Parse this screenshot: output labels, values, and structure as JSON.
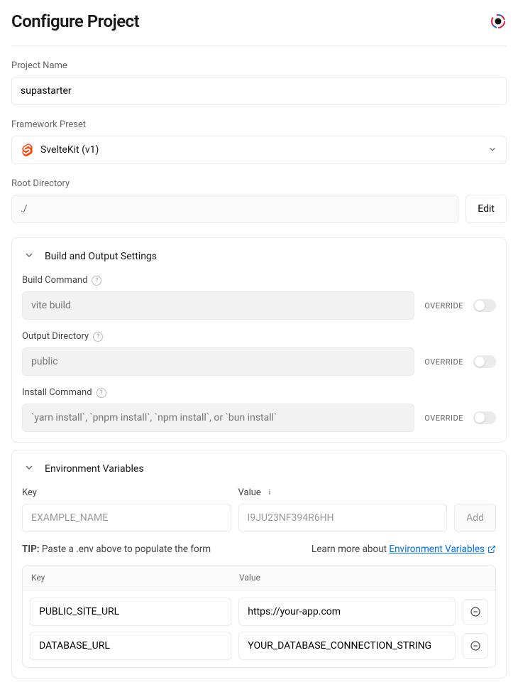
{
  "header": {
    "title": "Configure Project"
  },
  "projectName": {
    "label": "Project Name",
    "value": "supastarter"
  },
  "frameworkPreset": {
    "label": "Framework Preset",
    "value": "SvelteKit (v1)"
  },
  "rootDirectory": {
    "label": "Root Directory",
    "value": "./",
    "editLabel": "Edit"
  },
  "buildPanel": {
    "title": "Build and Output Settings",
    "overrideLabel": "OVERRIDE",
    "buildCommand": {
      "label": "Build Command",
      "placeholder": "vite build"
    },
    "outputDirectory": {
      "label": "Output Directory",
      "placeholder": "public"
    },
    "installCommand": {
      "label": "Install Command",
      "placeholder": "`yarn install`, `pnpm install`, `npm install`, or `bun install`"
    }
  },
  "envPanel": {
    "title": "Environment Variables",
    "keyLabel": "Key",
    "valueLabel": "Value",
    "keyPlaceholder": "EXAMPLE_NAME",
    "valuePlaceholder": "I9JU23NF394R6HH",
    "addLabel": "Add",
    "tipBold": "TIP:",
    "tipText": " Paste a .env above to populate the form",
    "learnText": "Learn more about ",
    "linkText": "Environment Variables",
    "headKey": "Key",
    "headValue": "Value",
    "rows": [
      {
        "key": "PUBLIC_SITE_URL",
        "value": "https://your-app.com"
      },
      {
        "key": "DATABASE_URL",
        "value": "YOUR_DATABASE_CONNECTION_STRING"
      }
    ]
  }
}
